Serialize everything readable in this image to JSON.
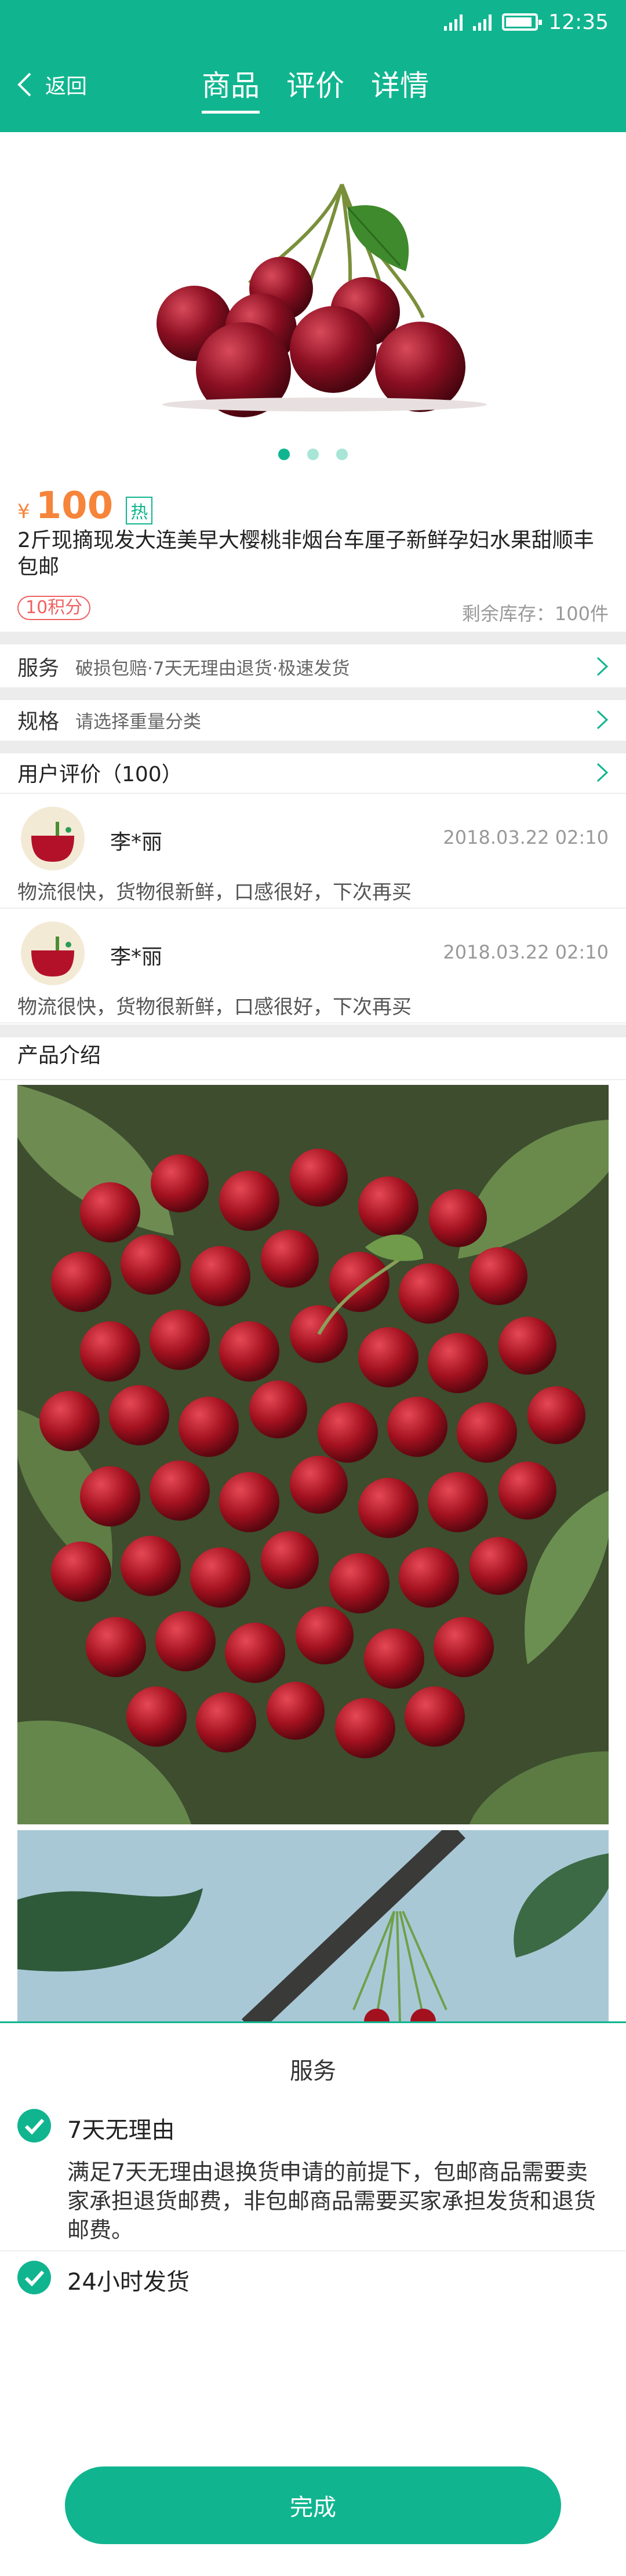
{
  "status_bar": {
    "time": "12:35",
    "signal_icons": [
      "signal-icon",
      "signal-icon"
    ],
    "battery_icon": "battery-icon"
  },
  "nav": {
    "back_label": "返回",
    "tabs": [
      {
        "label": "商品",
        "active": true
      },
      {
        "label": "评价",
        "active": false
      },
      {
        "label": "详情",
        "active": false
      }
    ]
  },
  "carousel": {
    "page_count": 3,
    "current_page": 1
  },
  "product": {
    "currency": "¥",
    "price": "100",
    "hot_badge": "热",
    "title": "2斤现摘现发大连美早大樱桃非烟台车厘子新鲜孕妇水果甜顺丰包邮",
    "points": "10积分",
    "stock": "剩余库存：100件"
  },
  "service_row": {
    "label": "服务",
    "desc": "破损包赔·7天无理由退货·极速发货"
  },
  "spec_row": {
    "label": "规格",
    "desc": "请选择重量分类"
  },
  "reviews": {
    "header": "用户评价（100）",
    "items": [
      {
        "name": "李*丽",
        "time": "2018.03.22  02:10",
        "text": "物流很快，货物很新鲜，口感很好，下次再买"
      },
      {
        "name": "李*丽",
        "time": "2018.03.22  02:10",
        "text": "物流很快，货物很新鲜，口感很好，下次再买"
      }
    ]
  },
  "intro": {
    "header": "产品介绍"
  },
  "sheet": {
    "title": "服务",
    "services": [
      {
        "name": "7天无理由",
        "desc": "满足7天无理由退换货申请的前提下，包邮商品需要卖家承担退货邮费，非包邮商品需要买家承担发货和退货邮费。"
      },
      {
        "name": "24小时发货",
        "desc": ""
      }
    ],
    "done_label": "完成"
  },
  "colors": {
    "brand": "#10b58f",
    "price": "#f6843a",
    "points": "#f06060"
  }
}
